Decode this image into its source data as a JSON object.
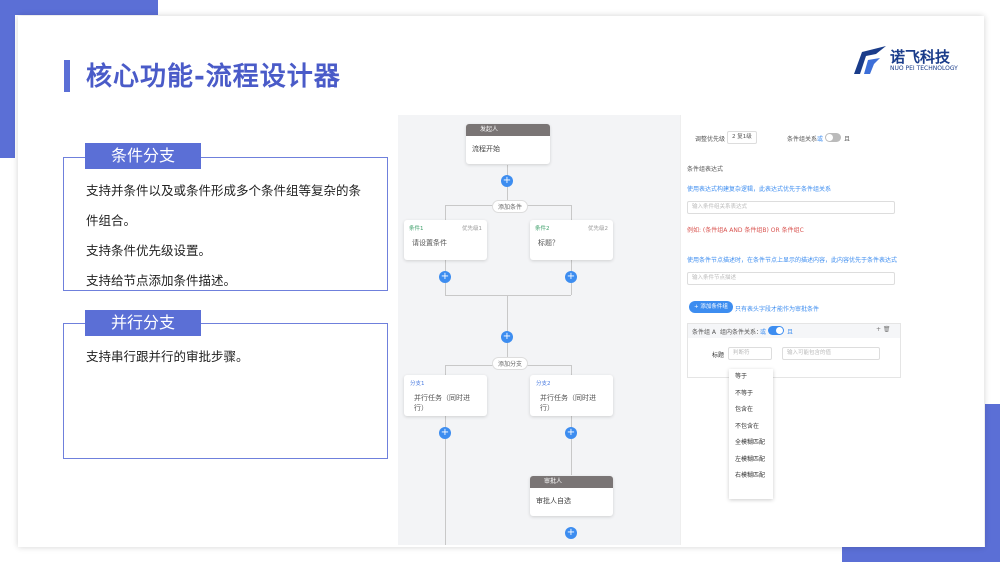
{
  "colors": {
    "accent": "#5b6fd6",
    "flow_blue": "#3d8df0",
    "condition_green": "#3fa06b",
    "error_red": "#d9534f"
  },
  "slide": {
    "title": "核心功能-流程设计器"
  },
  "logo": {
    "name": "诺飞科技",
    "en": "NUO PEI TECHNOLOGY"
  },
  "features": [
    {
      "tag": "条件分支",
      "lines": [
        "支持并条件以及或条件形成多个条件组等复杂的条",
        "件组合。",
        "支持条件优先级设置。",
        "支持给节点添加条件描述。"
      ]
    },
    {
      "tag": "并行分支",
      "lines": [
        "支持串行跟并行的审批步骤。"
      ]
    }
  ],
  "flow": {
    "start": {
      "head": "发起人",
      "body": "流程开始"
    },
    "add_condition": "添加条件",
    "cond1": {
      "label": "条件1",
      "priority": "优先级1",
      "text": "请设置条件"
    },
    "cond2": {
      "label": "条件2",
      "priority": "优先级2",
      "text": "标题？"
    },
    "add_branch": "添加分支",
    "par1": {
      "label": "分支1",
      "text": "并行任务（同时进行）"
    },
    "par2": {
      "label": "分支2",
      "text": "并行任务（同时进行）"
    },
    "approver": {
      "head": "审批人",
      "body": "审批人自选"
    },
    "plus": "+"
  },
  "panel": {
    "priority_label": "调整优先级",
    "priority_value": "2 复1级",
    "relation_label": "条件组关系",
    "relation_or": "或",
    "relation_and": "且",
    "expr_title": "条件组表达式",
    "expr_hint": "使用表达式构建复杂逻辑，此表达式优先于条件组关系",
    "expr_placeholder": "输入条件组关系表达式",
    "example": "例如: (条件组A AND 条件组B) OR 条件组C",
    "desc_hint": "使用条件节点描述时，在条件节点上显示的描述内容，此内容优先于条件表达式",
    "desc_placeholder": "输入条件节点描述",
    "add_group_btn": "+ 添加条件组",
    "add_group_hint": "只有表头字段才能作为审批条件",
    "group_name": "条件组 A",
    "group_rel_label": "组内条件关系：",
    "group_or": "或",
    "group_and": "且",
    "group_icons": "+ 🗑",
    "field_label": "标题",
    "field_select": "判断符",
    "field_value_placeholder": "输入可能包含的值",
    "options": [
      "等于",
      "不等于",
      "包含在",
      "不包含在",
      "全模糊匹配",
      "左模糊匹配",
      "右模糊匹配"
    ]
  }
}
